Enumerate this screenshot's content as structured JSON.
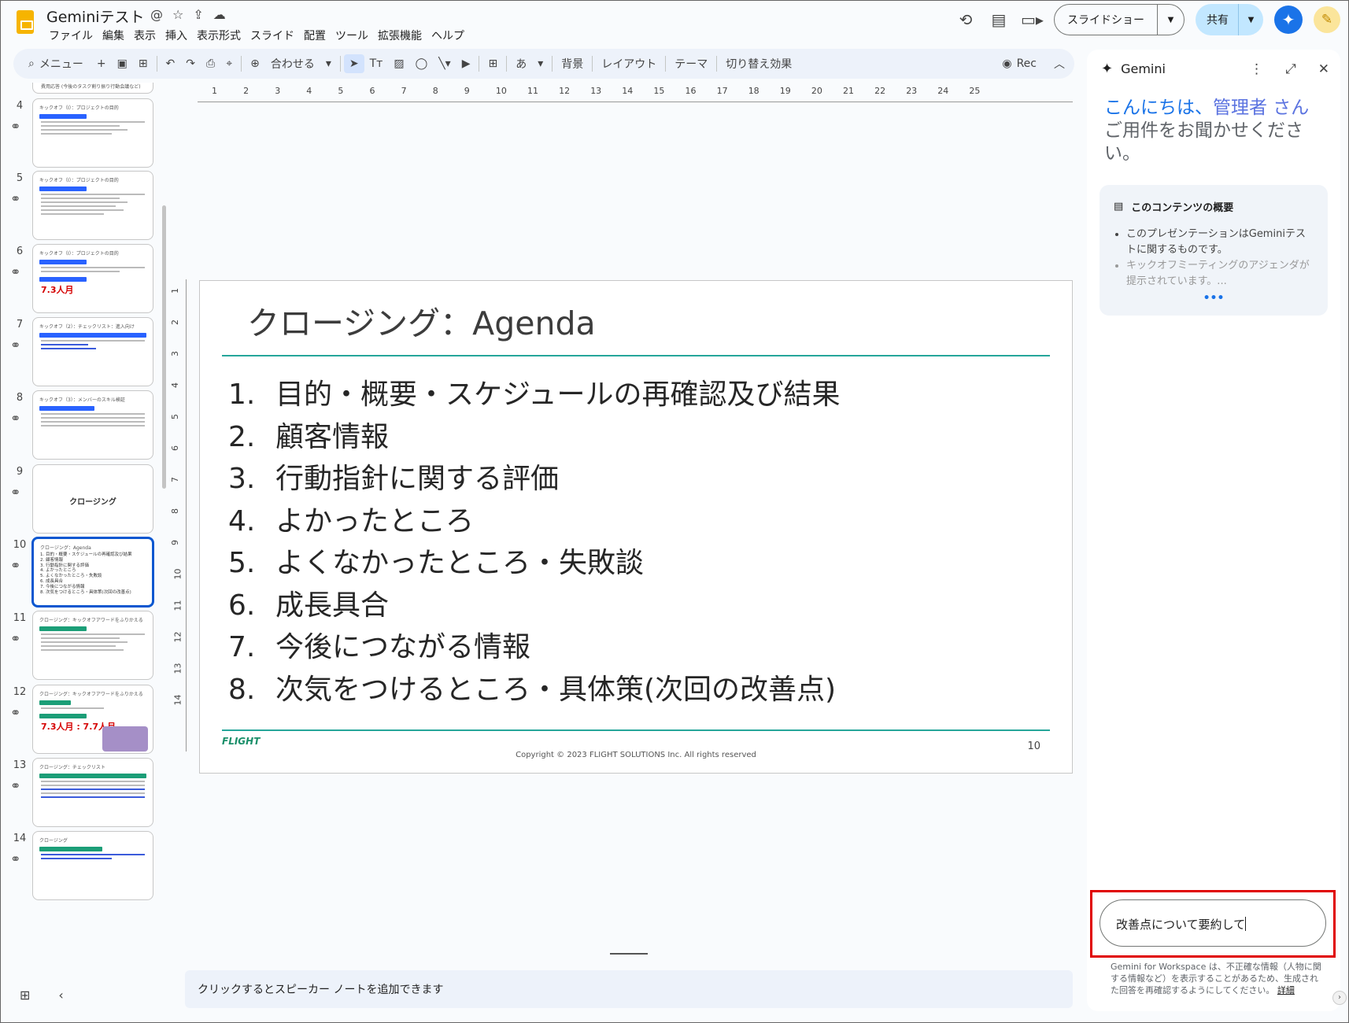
{
  "app": {
    "title": "Geminiテスト",
    "title_icons": [
      "@",
      "☆",
      "⇪",
      "☁"
    ],
    "menu": [
      "ファイル",
      "編集",
      "表示",
      "挿入",
      "表示形式",
      "スライド",
      "配置",
      "ツール",
      "拡張機能",
      "ヘルプ"
    ]
  },
  "header": {
    "slideshow_label": "スライドショー",
    "share_label": "共有"
  },
  "toolbar": {
    "menu_label": "メニュー",
    "zoom_label": "合わせる",
    "lang_label": "あ",
    "background_label": "背景",
    "layout_label": "レイアウト",
    "theme_label": "テーマ",
    "transition_label": "切り替え効果",
    "rec_label": "Rec"
  },
  "filmstrip": {
    "top_partial": "費用応答 (今後のタスク割り振り行動会議など)",
    "slides": [
      {
        "num": "4",
        "title": "キックオフ（I）：プロジェクトの目的"
      },
      {
        "num": "5",
        "title": "キックオフ（I）：プロジェクトの目的"
      },
      {
        "num": "6",
        "title": "キックオフ（I）：プロジェクトの目的",
        "value": "7.3人月"
      },
      {
        "num": "7",
        "title": "キックオフ（2）：チェックリスト：進入向け"
      },
      {
        "num": "8",
        "title": "キックオフ（3）：メンバーのスキル検証"
      },
      {
        "num": "9",
        "title": "クロージング"
      },
      {
        "num": "10",
        "title": "クロージング：Agenda",
        "items": [
          "1. 目的・概要・スケジュールの再確認及び結果",
          "2. 顧客情報",
          "3. 行動指針に関する評価",
          "4. よかったところ",
          "5. よくなかったところ・失敗談",
          "6. 成長具合",
          "7. 今後につながる情報",
          "8. 次気をつけるところ・具体策(次回の改善点)"
        ]
      },
      {
        "num": "11",
        "title": "クロージング：キックオフアワードをふりかえる"
      },
      {
        "num": "12",
        "title": "クロージング：キックオフアワードをふりかえる",
        "value": "7.3人月 : 7.7人月"
      },
      {
        "num": "13",
        "title": "クロージング：チェックリスト"
      },
      {
        "num": "14",
        "title": "クロージング"
      }
    ]
  },
  "rulers": {
    "top": [
      "1",
      "2",
      "3",
      "4",
      "5",
      "6",
      "7",
      "8",
      "9",
      "10",
      "11",
      "12",
      "13",
      "14",
      "15",
      "16",
      "17",
      "18",
      "19",
      "20",
      "21",
      "22",
      "23",
      "24",
      "25"
    ],
    "left": [
      "1",
      "2",
      "3",
      "4",
      "5",
      "6",
      "7",
      "8",
      "9",
      "10",
      "11",
      "12",
      "13",
      "14"
    ]
  },
  "slide": {
    "title": "クロージング：Agenda",
    "agenda": [
      {
        "n": "1.",
        "text": "目的・概要・スケジュールの再確認及び結果"
      },
      {
        "n": "2.",
        "text": "顧客情報"
      },
      {
        "n": "3.",
        "text": "行動指針に関する評価"
      },
      {
        "n": "4.",
        "text": "よかったところ"
      },
      {
        "n": "5.",
        "text": "よくなかったところ・失敗談"
      },
      {
        "n": "6.",
        "text": "成長具合"
      },
      {
        "n": "7.",
        "text": "今後につながる情報"
      },
      {
        "n": "8.",
        "text": "次気をつけるところ・具体策(次回の改善点)"
      }
    ],
    "logo_text": "FLIGHT",
    "copyright": "Copyright © 2023 FLIGHT SOLUTIONS Inc. All rights reserved",
    "page_number": "10"
  },
  "notes": {
    "placeholder": "クリックするとスピーカー ノートを追加できます"
  },
  "gemini": {
    "title": "Gemini",
    "greeting_hi": "こんにちは、",
    "greeting_name": "管理者 さん",
    "greeting_ask": "ご用件をお聞かせください。",
    "summary_title": "このコンテンツの概要",
    "summary_items": [
      "このプレゼンテーションはGeminiテストに関するものです。",
      "キックオフミーティングのアジェンダが提示されています。..."
    ],
    "summary_more": "•••",
    "input_value": "改善点について要約して",
    "disclaimer": "Gemini for Workspace は、不正確な情報（人物に関する情報など）を表示することがあるため、生成された回答を再確認するようにしてください。",
    "disclaimer_link": "詳細"
  }
}
